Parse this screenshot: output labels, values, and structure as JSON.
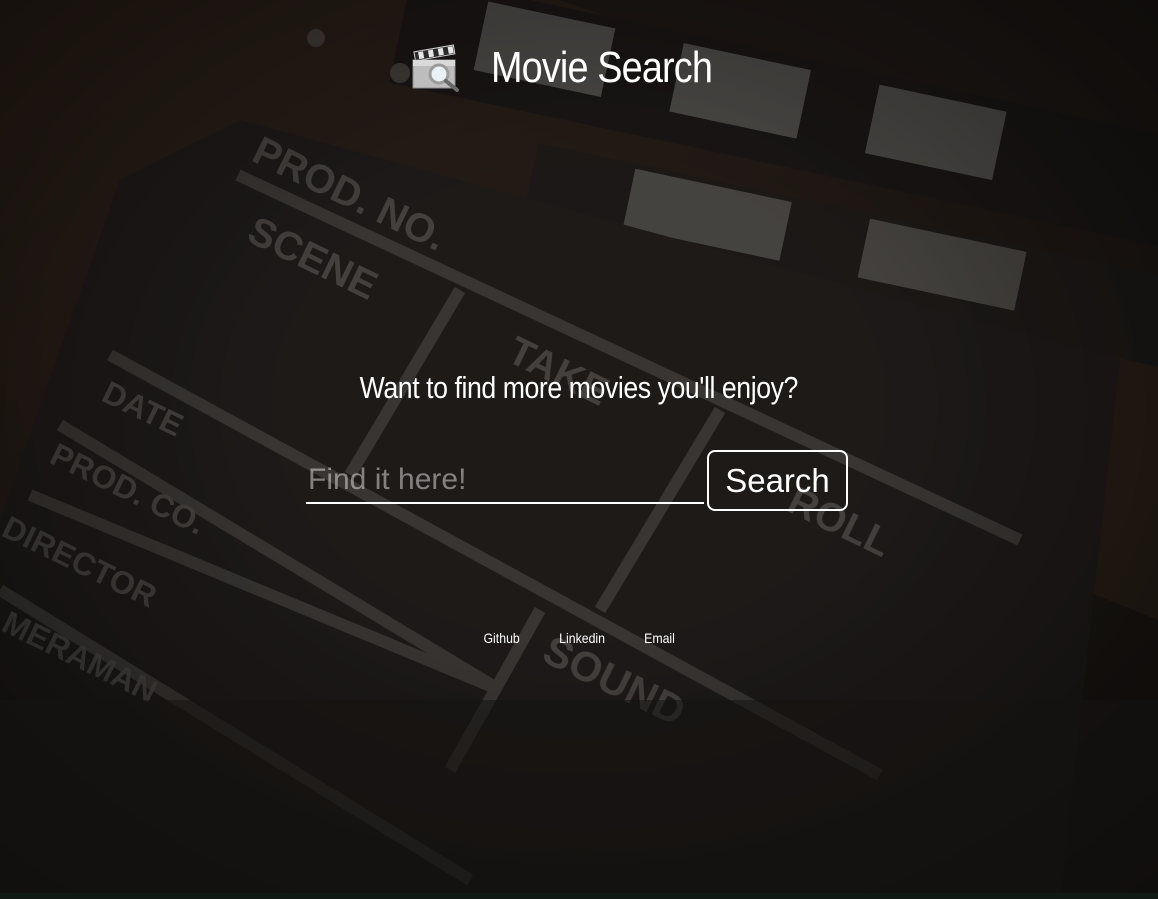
{
  "header": {
    "title": "Movie Search",
    "logo_icon": "clapperboard-magnifier-icon"
  },
  "main": {
    "tagline": "Want to find more movies you'll enjoy?",
    "search": {
      "placeholder": "Find it here!",
      "value": "",
      "button_label": "Search"
    }
  },
  "footer": {
    "links": [
      {
        "label": "Github"
      },
      {
        "label": "Linkedin"
      },
      {
        "label": "Email"
      }
    ]
  },
  "background": {
    "type": "clapperboard-photo",
    "overlay_color": "#1b1917",
    "board_text": {
      "prod_no": "PROD. NO.",
      "scene": "SCENE",
      "take": "TAKE",
      "roll": "ROLL",
      "date": "DATE",
      "prod_co": "PROD. CO.",
      "director": "DIRECTOR",
      "cameraman": "MERAMAN",
      "sound": "SOUND"
    }
  }
}
